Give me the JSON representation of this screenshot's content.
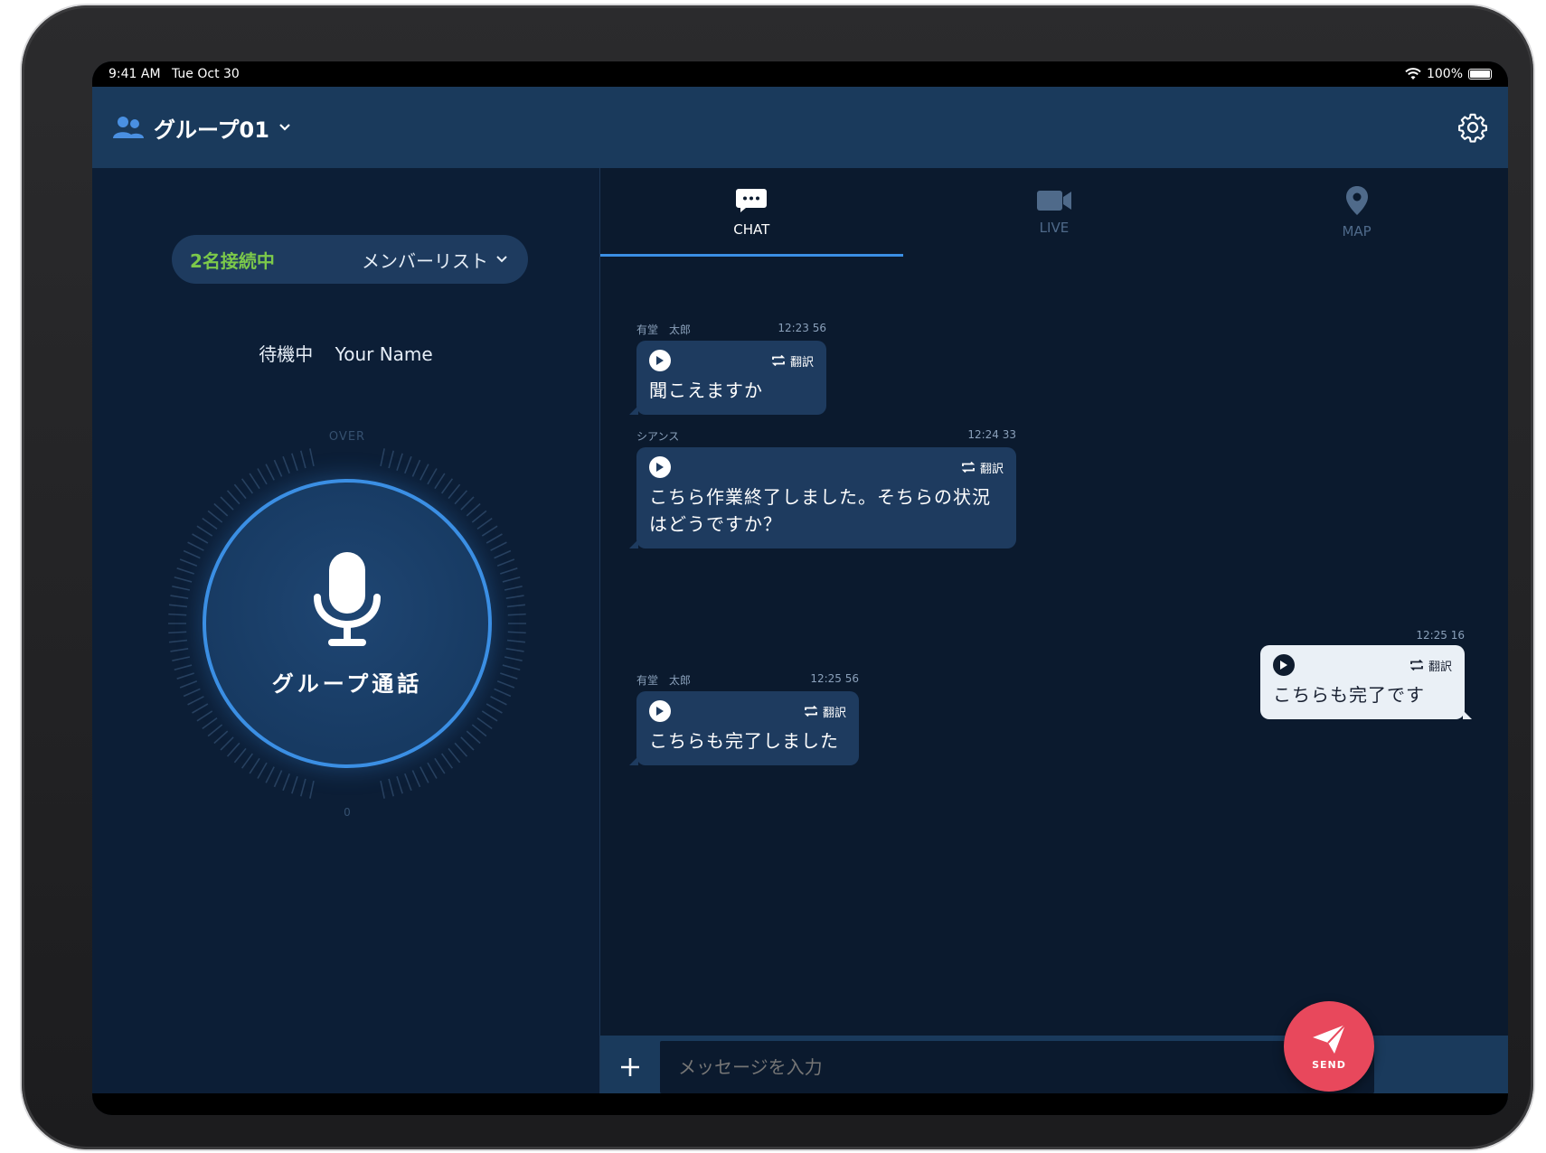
{
  "status_bar": {
    "time": "9:41 AM",
    "date": "Tue Oct 30",
    "battery": "100%"
  },
  "header": {
    "group_name": "グループ01"
  },
  "left_panel": {
    "online_count": "2名接続中",
    "member_list_label": "メンバーリスト",
    "status": "待機中",
    "user_name": "Your Name",
    "dial_top_label": "OVER",
    "dial_bottom_label": "0",
    "talk_button_label": "グループ通話"
  },
  "tabs": [
    {
      "label": "CHAT",
      "icon": "chat-bubble-icon",
      "active": true
    },
    {
      "label": "LIVE",
      "icon": "video-camera-icon",
      "active": false
    },
    {
      "label": "MAP",
      "icon": "map-pin-icon",
      "active": false
    }
  ],
  "messages": [
    {
      "sender": "有堂　太郎",
      "time": "12:23 56",
      "text": "聞こえますか",
      "translate_label": "翻訳",
      "direction": "incoming"
    },
    {
      "sender": "シアンス",
      "time": "12:24 33",
      "text": "こちら作業終了しました。そちらの状況はどうですか？",
      "translate_label": "翻訳",
      "direction": "incoming"
    },
    {
      "sender": "",
      "time": "12:25 16",
      "text": "こちらも完了です",
      "translate_label": "翻訳",
      "direction": "outgoing"
    },
    {
      "sender": "有堂　太郎",
      "time": "12:25 56",
      "text": "こちらも完了しました",
      "translate_label": "翻訳",
      "direction": "incoming"
    }
  ],
  "input": {
    "placeholder": "メッセージを入力",
    "value": ""
  },
  "send_button": {
    "label": "SEND"
  },
  "colors": {
    "accent": "#3b8fe4",
    "online": "#7cc94a",
    "send": "#e8485c",
    "header": "#1a3a5c",
    "background": "#0b1a2e"
  }
}
